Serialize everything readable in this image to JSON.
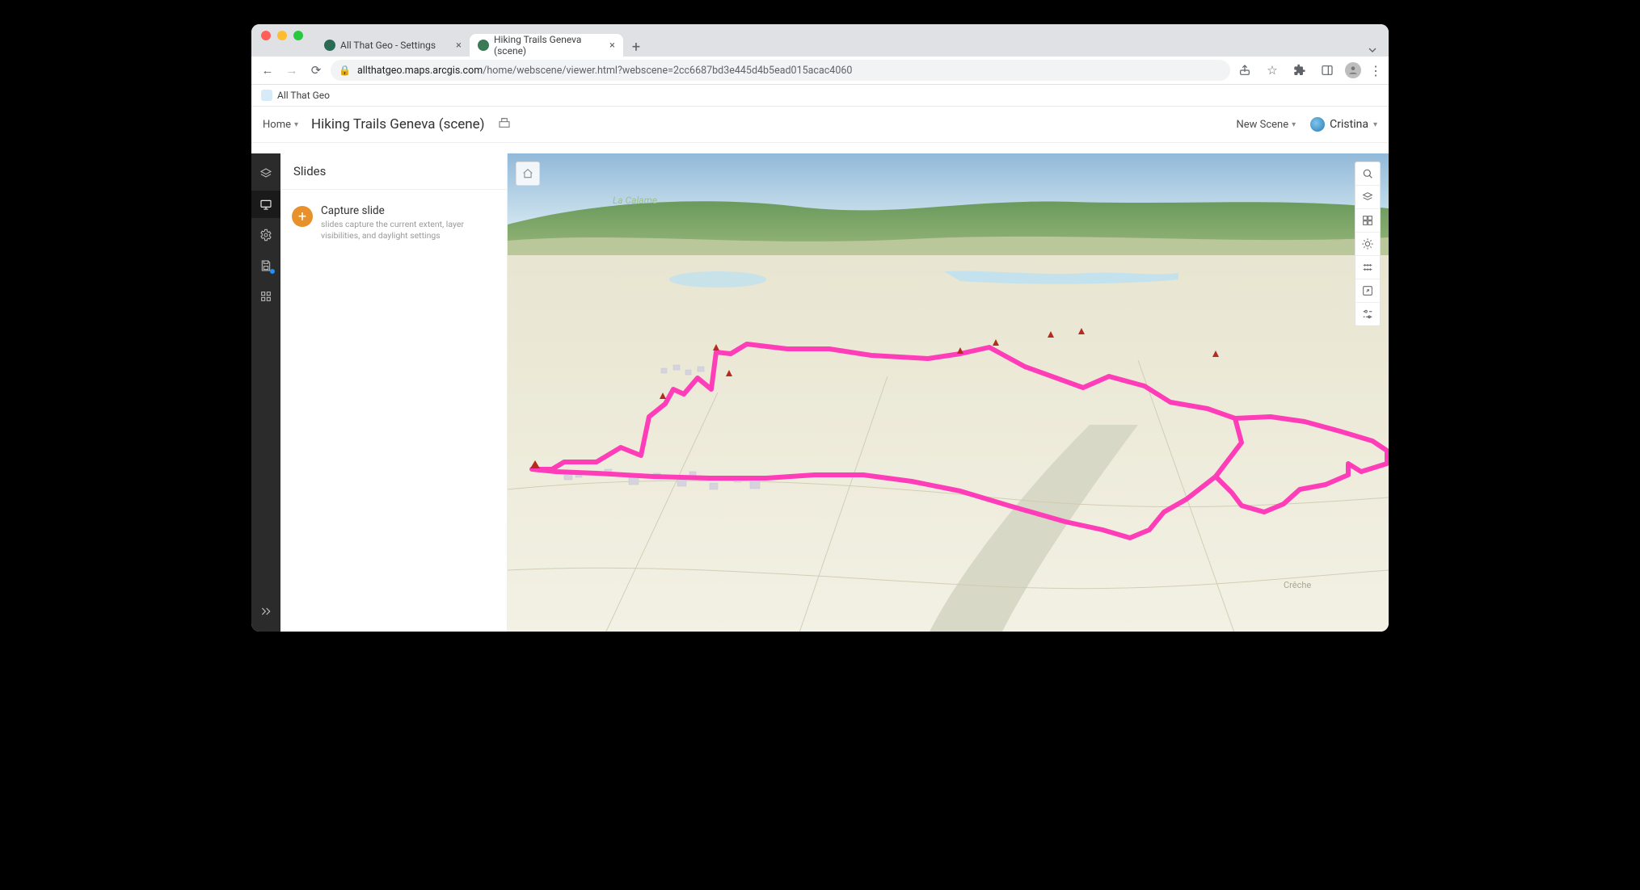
{
  "browser": {
    "tabs": [
      {
        "title": "All That Geo - Settings",
        "active": false
      },
      {
        "title": "Hiking Trails Geneva (scene)",
        "active": true
      }
    ],
    "url_host": "allthatgeo.maps.arcgis.com",
    "url_path": "/home/webscene/viewer.html?webscene=2cc6687bd3e445d4b5ead015acac4060",
    "bookmark": "All That Geo"
  },
  "app": {
    "home_label": "Home",
    "scene_title": "Hiking Trails Geneva (scene)",
    "new_scene_label": "New Scene",
    "user_name": "Cristina"
  },
  "sidebar": {
    "panel_title": "Slides",
    "capture_title": "Capture slide",
    "capture_sub": "slides capture the current extent, layer visibilities, and daylight settings",
    "rail": [
      {
        "name": "layers-icon",
        "active": false
      },
      {
        "name": "present-icon",
        "active": true
      },
      {
        "name": "settings-icon",
        "active": false
      },
      {
        "name": "save-icon",
        "active": false,
        "badge": true
      },
      {
        "name": "apps-icon",
        "active": false
      }
    ]
  },
  "map_tools_right": [
    "search-icon",
    "layers-icon",
    "basemap-icon",
    "daylight-icon",
    "measure-icon",
    "share-icon",
    "settings-gear-icon"
  ],
  "map": {
    "terrain_label": "La Calame",
    "place_label": "Crêche",
    "trail_color": "#ff3db8"
  }
}
